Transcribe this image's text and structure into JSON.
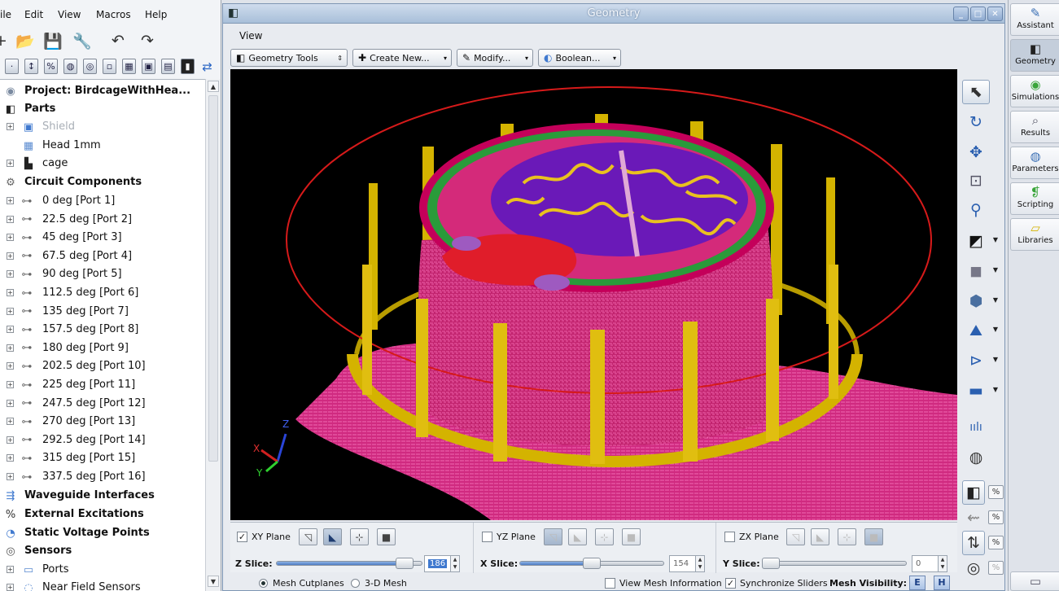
{
  "menu": {
    "file": "ile",
    "edit": "Edit",
    "view": "View",
    "macros": "Macros",
    "help": "Help"
  },
  "tree": {
    "project": "Project: BirdcageWithHea...",
    "parts": "Parts",
    "shield": "Shield",
    "head": "Head 1mm",
    "cage": "cage",
    "circuit_components": "Circuit Components",
    "ports": [
      "0 deg [Port 1]",
      "22.5 deg [Port 2]",
      "45 deg [Port 3]",
      "67.5 deg [Port 4]",
      "90 deg [Port 5]",
      "112.5 deg [Port 6]",
      "135 deg [Port 7]",
      "157.5 deg [Port 8]",
      "180 deg [Port 9]",
      "202.5 deg [Port 10]",
      "225 deg [Port 11]",
      "247.5 deg [Port 12]",
      "270 deg [Port 13]",
      "292.5 deg [Port 14]",
      "315 deg [Port 15]",
      "337.5 deg [Port 16]"
    ],
    "waveguide": "Waveguide Interfaces",
    "external": "External Excitations",
    "static_voltage": "Static Voltage Points",
    "sensors": "Sensors",
    "sensor_ports": "Ports",
    "near_field": "Near Field Sensors"
  },
  "window": {
    "title": "Geometry"
  },
  "geometry_menu": {
    "view": "View"
  },
  "toolbar": {
    "geometry_tools": "Geometry Tools",
    "create_new": "Create New...",
    "modify": "Modify...",
    "boolean": "Boolean..."
  },
  "axes": {
    "z": "Z",
    "x": "X",
    "y": "Y"
  },
  "slices": {
    "xy_plane": "XY Plane",
    "yz_plane": "YZ Plane",
    "zx_plane": "ZX Plane",
    "z_label": "Z Slice:",
    "x_label": "X Slice:",
    "y_label": "Y Slice:",
    "z_value": "186",
    "x_value": "154",
    "y_value": "0",
    "z_fraction": 0.93,
    "x_fraction": 0.5,
    "y_fraction": 0.0
  },
  "bottom": {
    "mesh_cutplanes": "Mesh Cutplanes",
    "mesh_3d": "3-D Mesh",
    "view_mesh_info": "View Mesh Information",
    "sync_sliders": "Synchronize Sliders",
    "mesh_visibility": "Mesh Visibility:",
    "e": "E",
    "h": "H"
  },
  "vtools": {
    "pct": "%"
  },
  "workspace_tabs": [
    "Assistant",
    "Geometry",
    "Simulations",
    "Results",
    "Parameters",
    "Scripting",
    "Libraries"
  ],
  "colors": {
    "accent": "#3f79cf",
    "titlebar": "#a8bfd9",
    "cage": "#d4b300",
    "tissue": "#e0338f"
  }
}
